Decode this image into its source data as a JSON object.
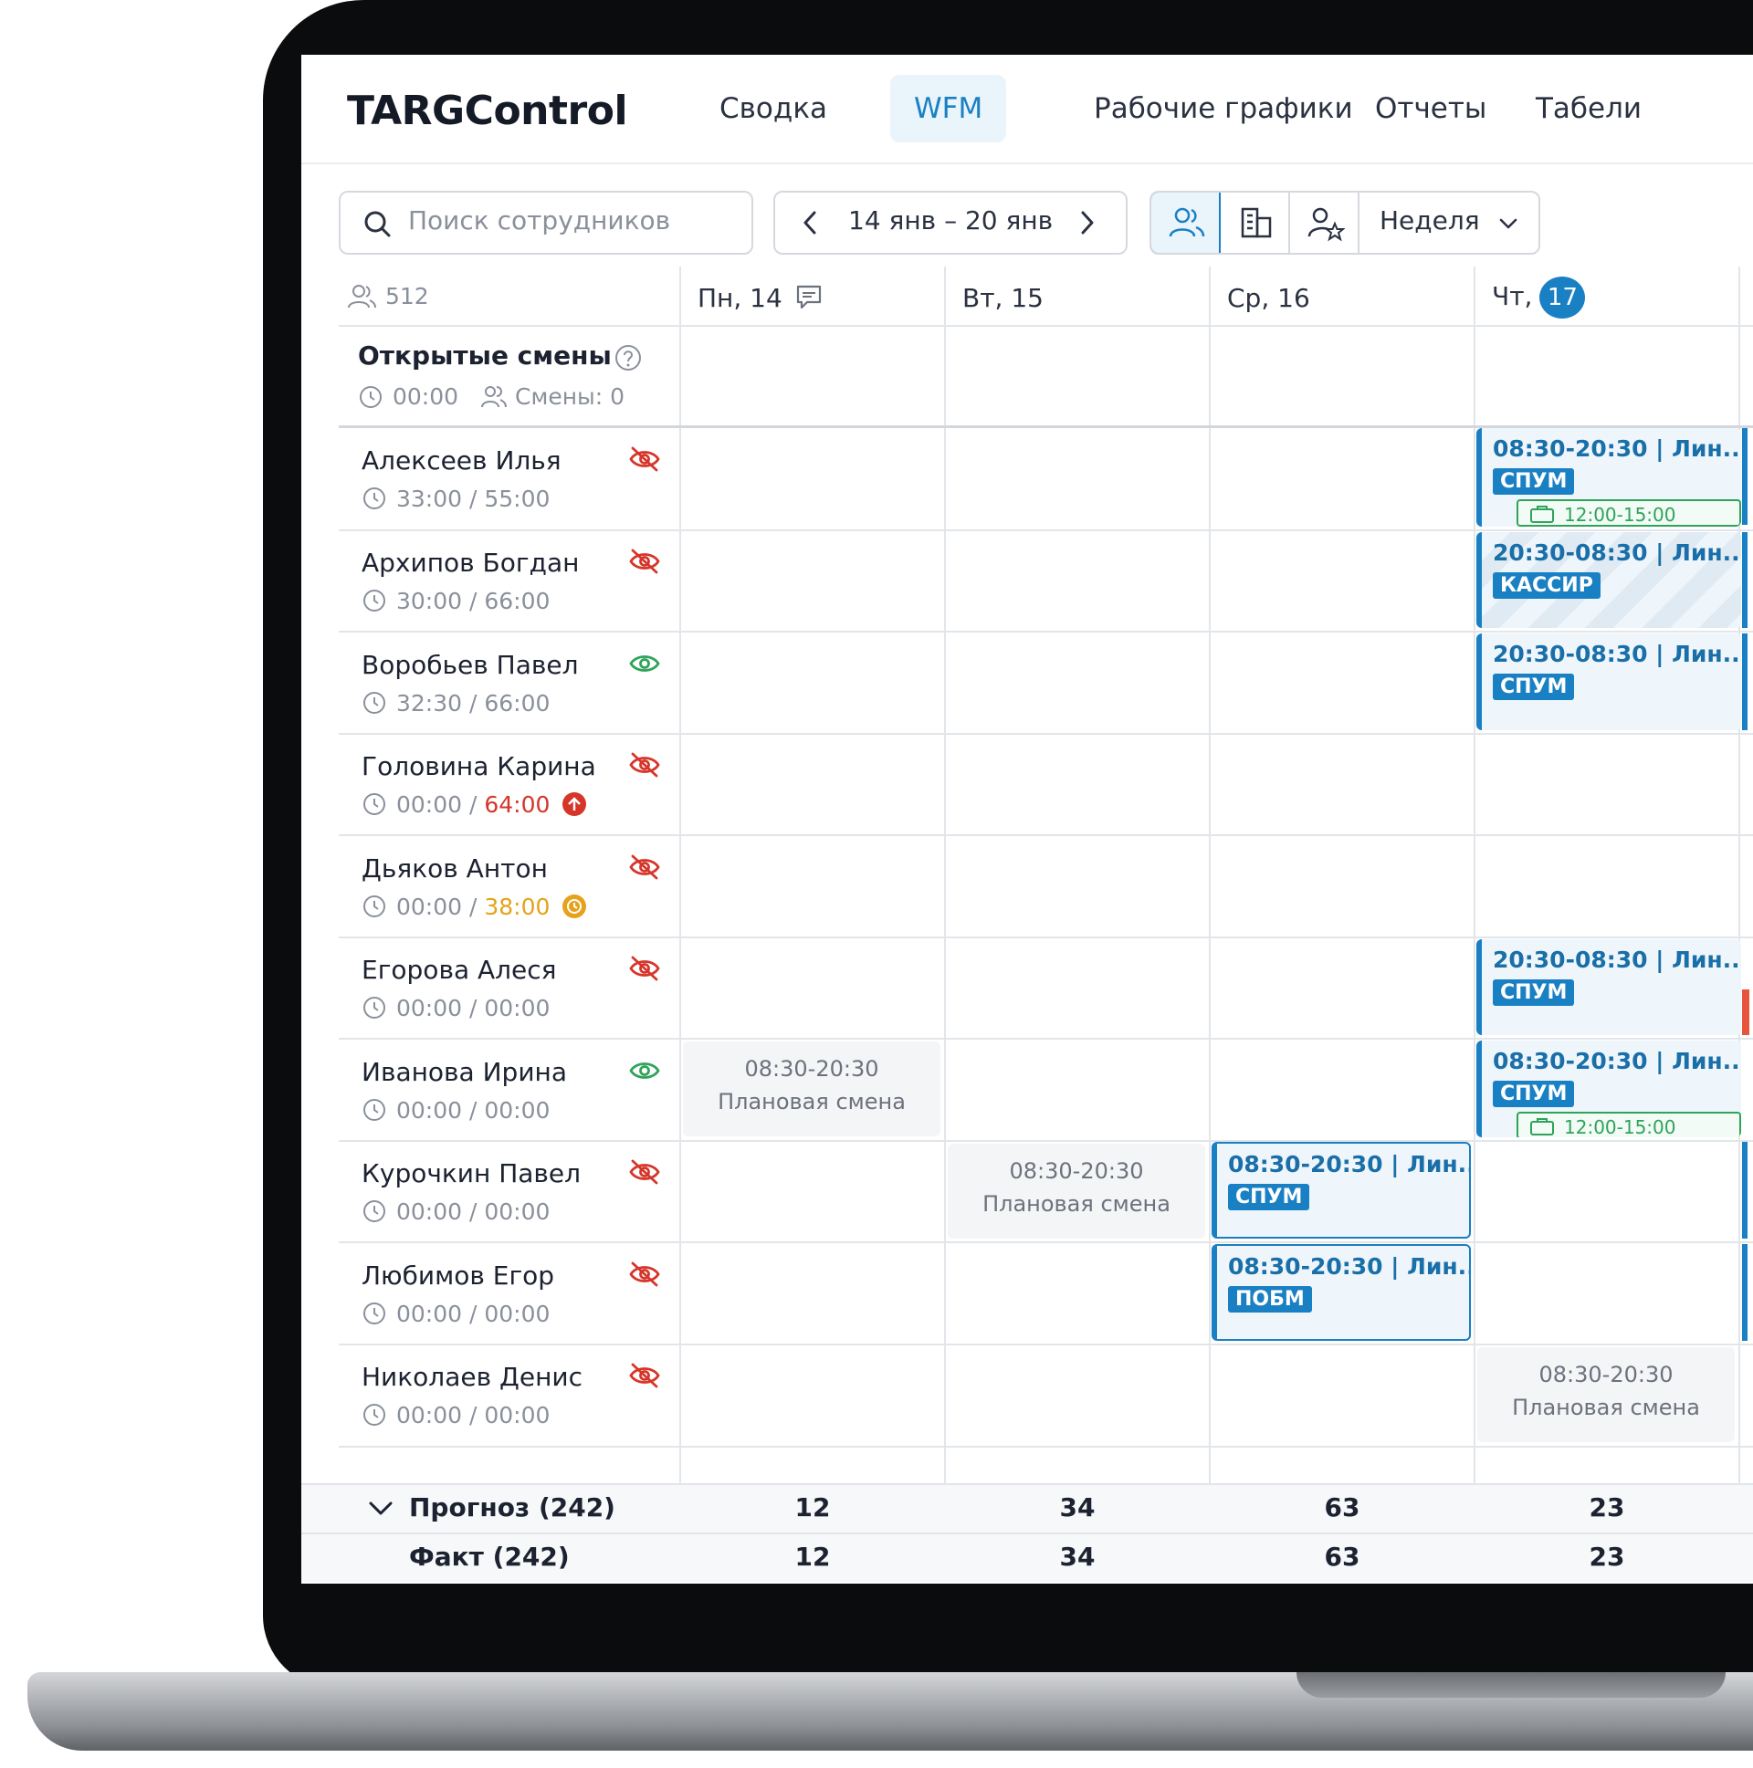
{
  "app": {
    "logo": "TARGControl"
  },
  "nav": [
    {
      "label": "Сводка",
      "active": false
    },
    {
      "label": "WFM",
      "active": true
    },
    {
      "label": "Рабочие графики",
      "active": false
    },
    {
      "label": "Отчеты",
      "active": false
    },
    {
      "label": "Табели",
      "active": false
    }
  ],
  "toolbar": {
    "search_placeholder": "Поиск сотрудников",
    "date_range": "14 янв – 20 янв",
    "period": "Неделя"
  },
  "header": {
    "employee_count": "512",
    "days": [
      {
        "label": "Пн, 14"
      },
      {
        "label": "Вт, 15"
      },
      {
        "label": "Ср, 16"
      },
      {
        "label": "Чт,",
        "today_badge": "17"
      }
    ]
  },
  "open_shifts": {
    "title": "Открытые смены",
    "time": "00:00",
    "count_label": "Смены: 0"
  },
  "employees": [
    {
      "name": "Алексеев Илья",
      "hours": "33:00",
      "planned": "55:00",
      "visible": false
    },
    {
      "name": "Архипов Богдан",
      "hours": "30:00",
      "planned": "66:00",
      "visible": false
    },
    {
      "name": "Воробьев Павел",
      "hours": "32:30",
      "planned": "66:00",
      "visible": true
    },
    {
      "name": "Головина Карина",
      "hours": "00:00",
      "planned": "64:00",
      "visible": false,
      "status": "over"
    },
    {
      "name": "Дьяков Антон",
      "hours": "00:00",
      "planned": "38:00",
      "visible": false,
      "status": "warn"
    },
    {
      "name": "Егорова Алеся",
      "hours": "00:00",
      "planned": "00:00",
      "visible": false
    },
    {
      "name": "Иванова Ирина",
      "hours": "00:00",
      "planned": "00:00",
      "visible": true
    },
    {
      "name": "Курочкин Павел",
      "hours": "00:00",
      "planned": "00:00",
      "visible": false
    },
    {
      "name": "Любимов Егор",
      "hours": "00:00",
      "planned": "00:00",
      "visible": false
    },
    {
      "name": "Николаев Денис",
      "hours": "00:00",
      "planned": "00:00",
      "visible": false
    }
  ],
  "shifts": [
    {
      "time": "08:30-20:30 | Лин...",
      "role": "СПУМ",
      "break": "12:00-15:00"
    },
    {
      "time": "20:30-08:30 | Лин...",
      "role": "КАССИР"
    },
    {
      "time": "20:30-08:30 | Лин...",
      "role": "СПУМ"
    },
    {
      "time": "20:30-08:30 | Лин...",
      "role": "СПУМ"
    },
    {
      "time": "08:30-20:30 | Лин...",
      "role": "СПУМ",
      "break": "12:00-15:00"
    },
    {
      "time": "08:30-20:30 | Лин...",
      "role": "СПУМ"
    },
    {
      "time": "08:30-20:30 | Лин...",
      "role": "ПОБМ"
    }
  ],
  "planned_shifts": [
    {
      "time": "08:30-20:30",
      "label": "Плановая смена"
    },
    {
      "time": "08:30-20:30",
      "label": "Плановая смена"
    },
    {
      "time": "08:30-20:30",
      "label": "Плановая смена"
    }
  ],
  "footer": {
    "forecast": {
      "label": "Прогноз (242)",
      "values": [
        "12",
        "34",
        "63",
        "23"
      ]
    },
    "fact": {
      "label": "Факт (242)",
      "values": [
        "12",
        "34",
        "63",
        "23"
      ]
    }
  },
  "colors": {
    "accent": "#1a80c4",
    "danger": "#d6352a",
    "warning": "#e5a21a",
    "success": "#2fa35a"
  }
}
